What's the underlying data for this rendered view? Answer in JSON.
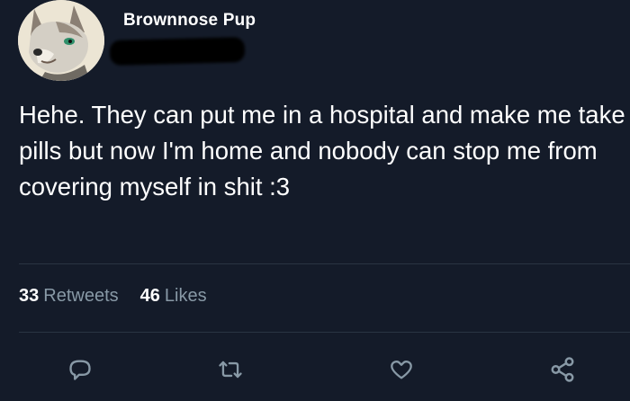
{
  "author": {
    "display_name": "Brownnose Pup",
    "avatar_icon": "wolf-avatar-icon"
  },
  "tweet": {
    "text": "Hehe. They can put me in a hospital and make me take pills but now I'm home and nobody can stop me from covering myself in shit :3"
  },
  "stats": {
    "retweets_count": "33",
    "retweets_label": "Retweets",
    "likes_count": "46",
    "likes_label": "Likes"
  },
  "actions": [
    {
      "name": "reply",
      "icon": "reply-icon"
    },
    {
      "name": "retweet",
      "icon": "retweet-icon"
    },
    {
      "name": "like",
      "icon": "heart-icon"
    },
    {
      "name": "share",
      "icon": "share-icon"
    }
  ],
  "colors": {
    "background": "#141b29",
    "text": "#ffffff",
    "muted": "#8899a6",
    "divider": "#2a3442"
  }
}
